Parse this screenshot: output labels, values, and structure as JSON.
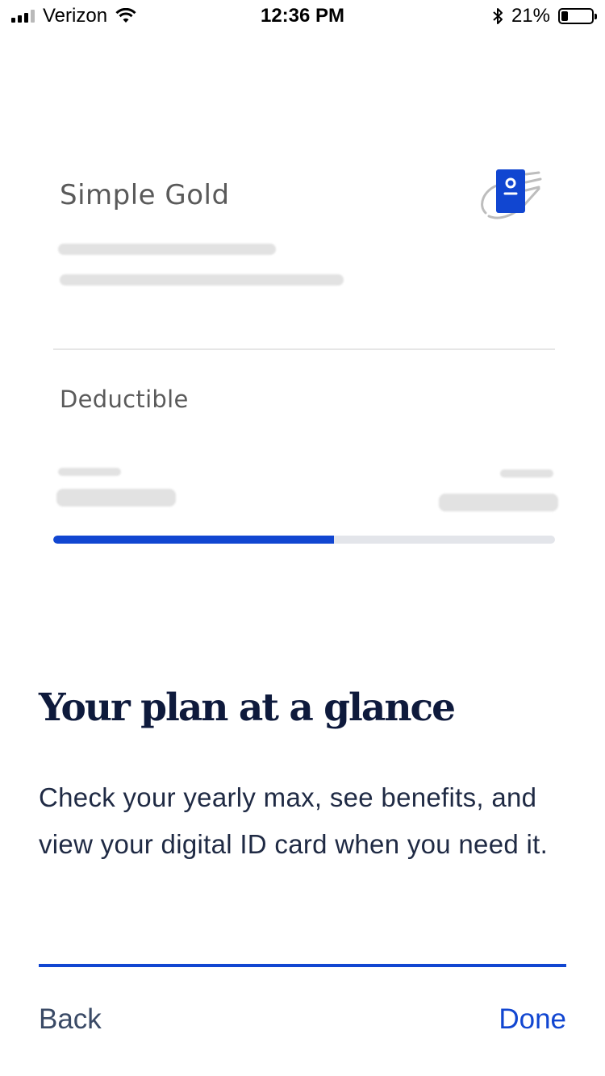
{
  "status_bar": {
    "carrier": "Verizon",
    "time": "12:36 PM",
    "battery_text": "21%",
    "battery_level": 0.21,
    "icons": [
      "signal-icon",
      "wifi-icon",
      "bluetooth-icon",
      "battery-icon"
    ]
  },
  "plan_card": {
    "plan_name": "Simple Gold",
    "icon": "id-card-icon",
    "deductible_label": "Deductible",
    "deductible_progress": 0.56
  },
  "intro": {
    "headline": "Your plan at a glance",
    "description": "Check your yearly max, see benefits, and view your digital ID card when you need it."
  },
  "footer": {
    "back_label": "Back",
    "done_label": "Done"
  },
  "colors": {
    "accent": "#1146d1",
    "headline": "#0e1a3c",
    "body_text": "#1f2a44",
    "placeholder": "#e2e2e2"
  }
}
